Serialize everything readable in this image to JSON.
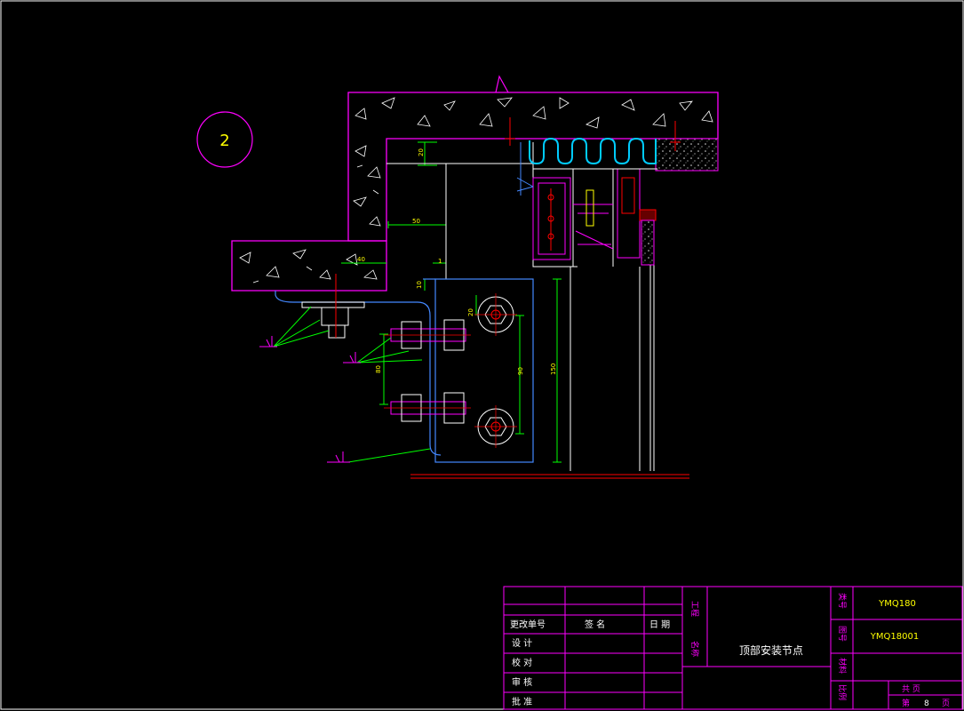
{
  "drawing": {
    "detail_marker": "2",
    "dims": {
      "d20_top": "20",
      "d50": "50",
      "d40": "40",
      "d1": "1",
      "d10": "10",
      "d20_plate": "20",
      "d80_left": "80",
      "d90": "90",
      "d150": "150"
    }
  },
  "title_block": {
    "labels": {
      "change_no": "更改单号",
      "sign": "签    名",
      "date": "日  期",
      "design": "设    计",
      "check": "校    对",
      "review": "审    核",
      "approve": "批    准",
      "project": "工程",
      "name": "名称",
      "category": "类号",
      "drawing_no": "图号",
      "material": "材料",
      "scale": "比例",
      "total": "共      页",
      "page_prefix": "第",
      "page_suffix": "页"
    },
    "values": {
      "drawing_name": "顶部安装节点",
      "category_code": "YMQ180",
      "drawing_code": "YMQ18001",
      "page_number": "8"
    }
  },
  "colors": {
    "background": "#000000",
    "frame": "#ffffff",
    "concrete_outline": "#ff00ff",
    "structure": "#ffffff",
    "dimension": "#00ff00",
    "dimension_text": "#ffff00",
    "steel": "#4488ff",
    "annotation": "#ff0000",
    "sealant": "#00ccff"
  }
}
